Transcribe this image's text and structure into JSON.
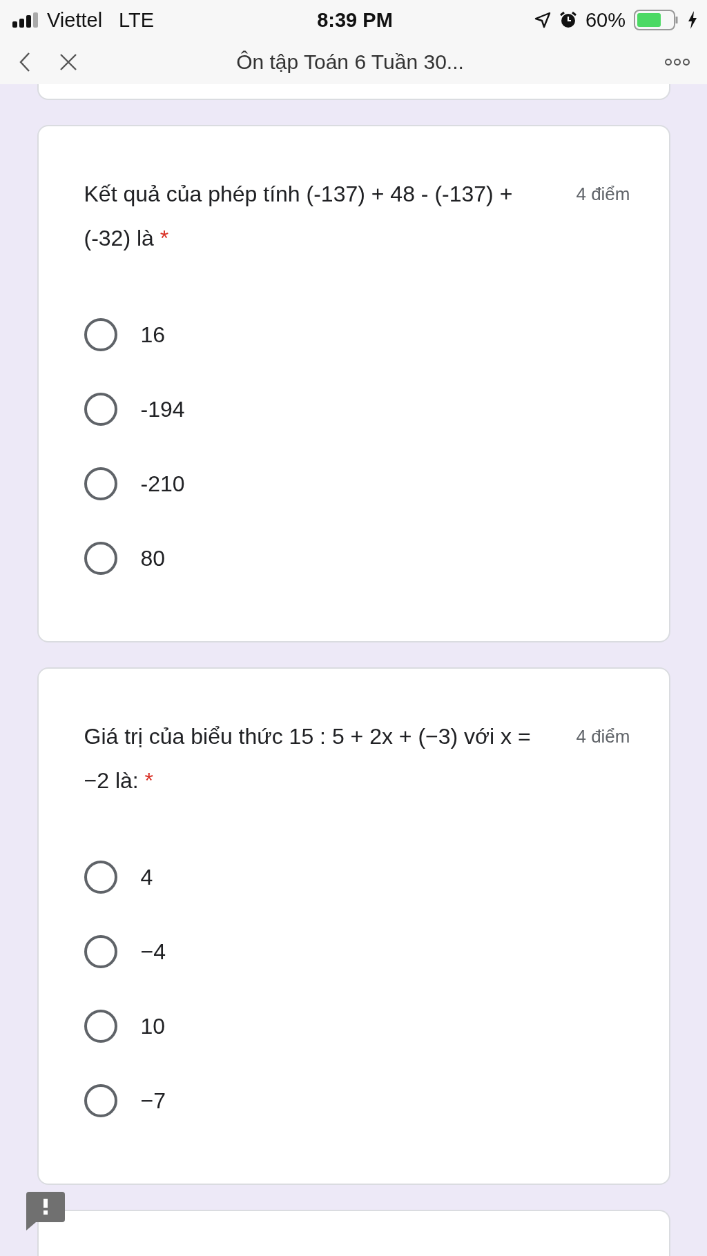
{
  "status_bar": {
    "carrier": "Viettel",
    "network": "LTE",
    "time": "8:39 PM",
    "battery": "60%"
  },
  "nav": {
    "title": "Ôn tập Toán 6 Tuần 30..."
  },
  "questions": [
    {
      "text": "Kết quả của phép tính (-137) + 48 - (-137) + (-32) là",
      "points": "4 điểm",
      "required_mark": "*",
      "options": [
        {
          "label": "16",
          "selected": false
        },
        {
          "label": "-194",
          "selected": false
        },
        {
          "label": "-210",
          "selected": false
        },
        {
          "label": "80",
          "selected": false
        }
      ]
    },
    {
      "text": "Giá trị của biểu thức 15 : 5 + 2x + (−3) với x = −2 là:",
      "points": "4 điểm",
      "required_mark": "*",
      "options": [
        {
          "label": "4",
          "selected": false
        },
        {
          "label": "−4",
          "selected": false
        },
        {
          "label": "10",
          "selected": false
        },
        {
          "label": "−7",
          "selected": false
        }
      ]
    }
  ]
}
